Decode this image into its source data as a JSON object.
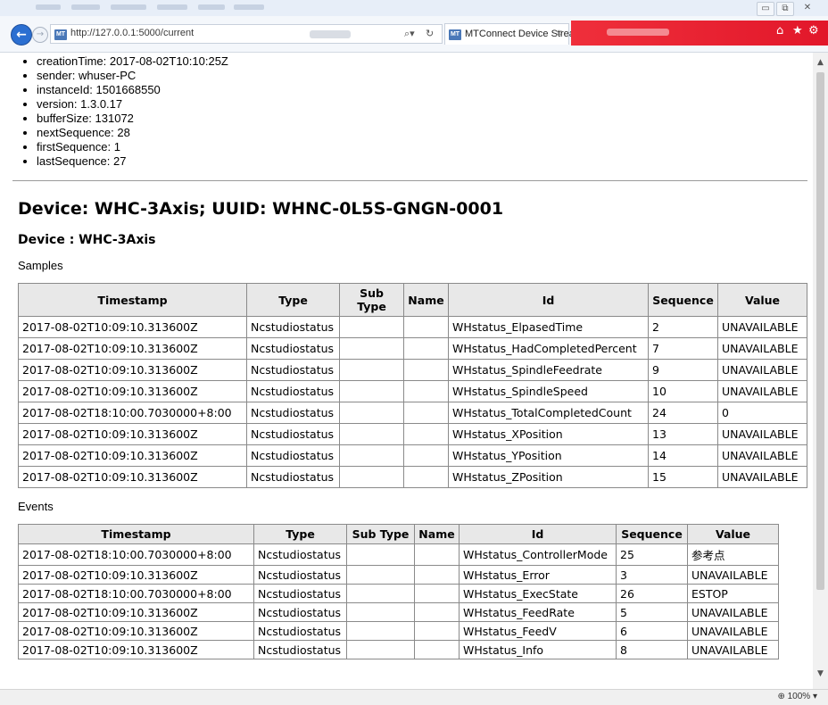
{
  "browser": {
    "url": "http://127.0.0.1:5000/current",
    "tab_title": "MTConnect Device Strea...",
    "favicon_text": "MT",
    "zoom": "100%"
  },
  "header_info": [
    "creationTime: 2017-08-02T10:10:25Z",
    "sender: whuser-PC",
    "instanceId: 1501668550",
    "version: 1.3.0.17",
    "bufferSize: 131072",
    "nextSequence: 28",
    "firstSequence: 1",
    "lastSequence: 27"
  ],
  "device_title": "Device: WHC-3Axis; UUID: WHNC-0L5S-GNGN-0001",
  "component_title": "Device : WHC-3Axis",
  "samples": {
    "label": "Samples",
    "columns": [
      "Timestamp",
      "Type",
      "Sub Type",
      "Name",
      "Id",
      "Sequence",
      "Value"
    ],
    "rows": [
      [
        "2017-08-02T10:09:10.313600Z",
        "Ncstudiostatus",
        "",
        "",
        "WHstatus_ElpasedTime",
        "2",
        "UNAVAILABLE"
      ],
      [
        "2017-08-02T10:09:10.313600Z",
        "Ncstudiostatus",
        "",
        "",
        "WHstatus_HadCompletedPercent",
        "7",
        "UNAVAILABLE"
      ],
      [
        "2017-08-02T10:09:10.313600Z",
        "Ncstudiostatus",
        "",
        "",
        "WHstatus_SpindleFeedrate",
        "9",
        "UNAVAILABLE"
      ],
      [
        "2017-08-02T10:09:10.313600Z",
        "Ncstudiostatus",
        "",
        "",
        "WHstatus_SpindleSpeed",
        "10",
        "UNAVAILABLE"
      ],
      [
        "2017-08-02T18:10:00.7030000+8:00",
        "Ncstudiostatus",
        "",
        "",
        "WHstatus_TotalCompletedCount",
        "24",
        "0"
      ],
      [
        "2017-08-02T10:09:10.313600Z",
        "Ncstudiostatus",
        "",
        "",
        "WHstatus_XPosition",
        "13",
        "UNAVAILABLE"
      ],
      [
        "2017-08-02T10:09:10.313600Z",
        "Ncstudiostatus",
        "",
        "",
        "WHstatus_YPosition",
        "14",
        "UNAVAILABLE"
      ],
      [
        "2017-08-02T10:09:10.313600Z",
        "Ncstudiostatus",
        "",
        "",
        "WHstatus_ZPosition",
        "15",
        "UNAVAILABLE"
      ]
    ]
  },
  "events": {
    "label": "Events",
    "columns": [
      "Timestamp",
      "Type",
      "Sub Type",
      "Name",
      "Id",
      "Sequence",
      "Value"
    ],
    "rows": [
      [
        "2017-08-02T18:10:00.7030000+8:00",
        "Ncstudiostatus",
        "",
        "",
        "WHstatus_ControllerMode",
        "25",
        "参考点"
      ],
      [
        "2017-08-02T10:09:10.313600Z",
        "Ncstudiostatus",
        "",
        "",
        "WHstatus_Error",
        "3",
        "UNAVAILABLE"
      ],
      [
        "2017-08-02T18:10:00.7030000+8:00",
        "Ncstudiostatus",
        "",
        "",
        "WHstatus_ExecState",
        "26",
        "ESTOP"
      ],
      [
        "2017-08-02T10:09:10.313600Z",
        "Ncstudiostatus",
        "",
        "",
        "WHstatus_FeedRate",
        "5",
        "UNAVAILABLE"
      ],
      [
        "2017-08-02T10:09:10.313600Z",
        "Ncstudiostatus",
        "",
        "",
        "WHstatus_FeedV",
        "6",
        "UNAVAILABLE"
      ],
      [
        "2017-08-02T10:09:10.313600Z",
        "Ncstudiostatus",
        "",
        "",
        "WHstatus_Info",
        "8",
        "UNAVAILABLE"
      ]
    ]
  },
  "icons": {
    "back": "back-arrow-icon",
    "forward": "forward-arrow-icon",
    "search": "search-icon",
    "refresh": "refresh-icon",
    "home": "home-icon",
    "favorites": "star-icon",
    "settings": "gear-icon"
  },
  "colors": {
    "header_accent": "#e2172a",
    "back_button": "#2b6fd1",
    "table_header_bg": "#e8e8e8"
  }
}
